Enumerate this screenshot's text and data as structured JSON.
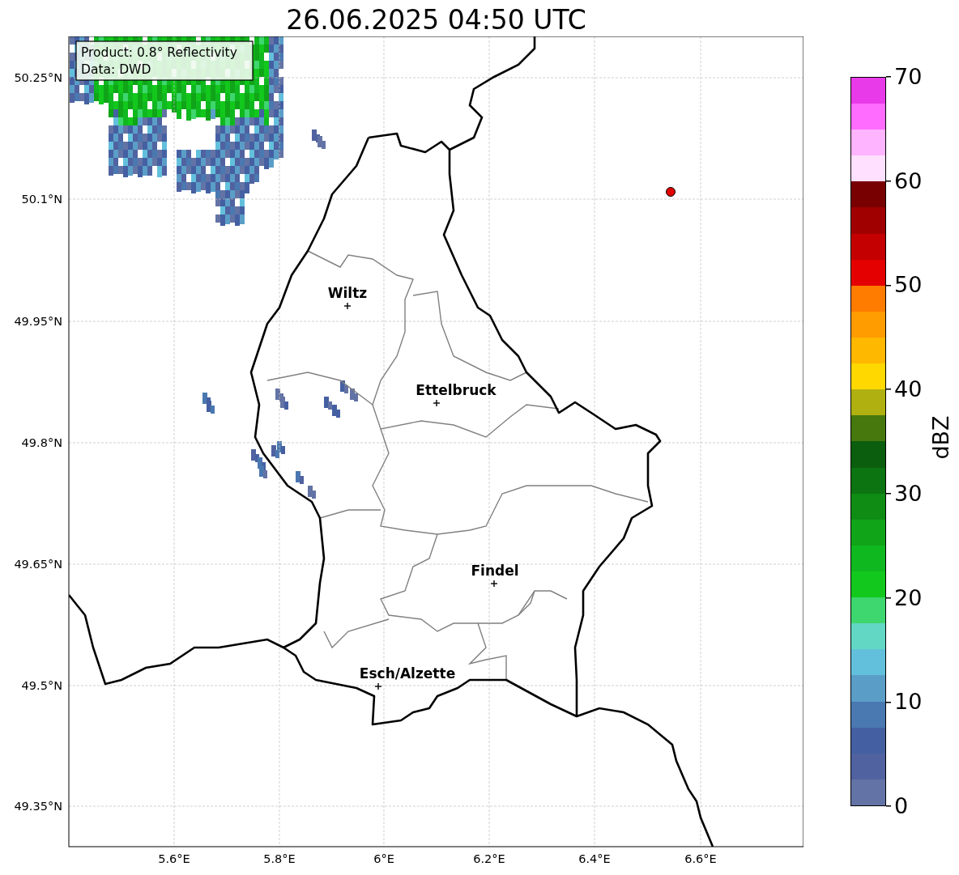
{
  "title": "26.06.2025 04:50 UTC",
  "info_box": {
    "lines": [
      "Product: 0.8° Reflectivity",
      "Data: DWD"
    ]
  },
  "map": {
    "lat_labels": [
      "50.25°N",
      "50.1°N",
      "49.95°N",
      "49.8°N",
      "49.65°N",
      "49.5°N",
      "49.35°N"
    ],
    "lon_labels": [
      "5.6°E",
      "5.8°E",
      "6°E",
      "6.2°E",
      "6.4°E",
      "6.6°E"
    ],
    "cities": [
      {
        "name": "Wiltz"
      },
      {
        "name": "Ettelbruck"
      },
      {
        "name": "Findel"
      },
      {
        "name": "Esch/Alzette"
      }
    ]
  },
  "colorbar": {
    "label": "dBZ",
    "ticks": [
      "70",
      "60",
      "50",
      "40",
      "30",
      "20",
      "10",
      "0"
    ],
    "segments": [
      {
        "color": "#6373a5"
      },
      {
        "color": "#5062a0"
      },
      {
        "color": "#4560a2"
      },
      {
        "color": "#4a78b0"
      },
      {
        "color": "#5a9ec8"
      },
      {
        "color": "#62c0dc"
      },
      {
        "color": "#62d8c4"
      },
      {
        "color": "#3ed66e"
      },
      {
        "color": "#12c81c"
      },
      {
        "color": "#10b820"
      },
      {
        "color": "#10a418"
      },
      {
        "color": "#0e8c14"
      },
      {
        "color": "#0c7410"
      },
      {
        "color": "#0a5e0e"
      },
      {
        "color": "#46780e"
      },
      {
        "color": "#b0b010"
      },
      {
        "color": "#ffd800"
      },
      {
        "color": "#ffb800"
      },
      {
        "color": "#ff9c00"
      },
      {
        "color": "#ff7c00"
      },
      {
        "color": "#e40000"
      },
      {
        "color": "#c40000"
      },
      {
        "color": "#a00000"
      },
      {
        "color": "#780000"
      },
      {
        "color": "#ffe0ff"
      },
      {
        "color": "#ffb4ff"
      },
      {
        "color": "#ff6cff"
      },
      {
        "color": "#e83ae8"
      }
    ]
  }
}
